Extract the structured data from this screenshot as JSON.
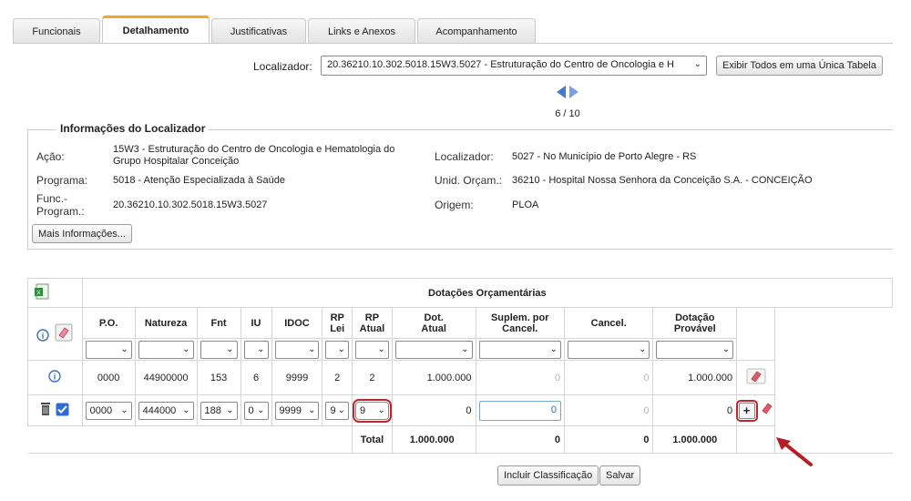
{
  "tabs": [
    {
      "label": "Funcionais"
    },
    {
      "label": "Detalhamento"
    },
    {
      "label": "Justificativas"
    },
    {
      "label": "Links e Anexos"
    },
    {
      "label": "Acompanhamento"
    }
  ],
  "localizador": {
    "label": "Localizador:",
    "selected": "20.36210.10.302.5018.15W3.5027 - Estruturação do Centro de Oncologia e H",
    "show_all_button": "Exibir Todos em uma Única Tabela",
    "page": "6 / 10"
  },
  "info": {
    "legend": "Informações do Localizador",
    "acao_label": "Ação:",
    "acao_value": "15W3 - Estruturação do Centro de Oncologia e Hematologia do Grupo Hospitalar Conceição",
    "programa_label": "Programa:",
    "programa_value": "5018 - Atenção Especializada à Saúde",
    "func_label": "Func.-Program.:",
    "func_value": "20.36210.10.302.5018.15W3.5027",
    "localizador_label": "Localizador:",
    "localizador_value": "5027 - No Município de Porto Alegre - RS",
    "unid_label": "Unid. Orçam.:",
    "unid_value": "36210 - Hospital Nossa Senhora da Conceição S.A. - CONCEIÇÃO",
    "origem_label": "Origem:",
    "origem_value": "PLOA",
    "more_button": "Mais Informações..."
  },
  "table": {
    "title": "Dotações Orçamentárias",
    "headers": {
      "po": "P.O.",
      "natureza": "Natureza",
      "fnt": "Fnt",
      "iu": "IU",
      "idoc": "IDOC",
      "rp_lei_1": "RP",
      "rp_lei_2": "Lei",
      "rp_atual_1": "RP",
      "rp_atual_2": "Atual",
      "dot_atual_1": "Dot.",
      "dot_atual_2": "Atual",
      "suplem_1": "Suplem. por",
      "suplem_2": "Cancel.",
      "cancel": "Cancel.",
      "dotacao_1": "Dotação",
      "dotacao_2": "Provável"
    },
    "row1": {
      "po": "0000",
      "natureza": "44900000",
      "fnt": "153",
      "iu": "6",
      "idoc": "9999",
      "rp_lei": "2",
      "rp_atual": "2",
      "dot_atual": "1.000.000",
      "suplem": "0",
      "cancel": "0",
      "dotacao": "1.000.000"
    },
    "row2": {
      "po": "0000",
      "natureza": "444000",
      "fnt": "188",
      "iu": "0",
      "idoc": "9999",
      "rp_lei": "9",
      "rp_atual": "9",
      "dot_atual": "0",
      "suplem": "0",
      "cancel": "0",
      "dotacao": "0",
      "add_button": "+"
    },
    "total": {
      "label": "Total",
      "dot_atual": "1.000.000",
      "suplem": "0",
      "cancel": "0",
      "dotacao": "1.000.000"
    }
  },
  "actions": {
    "incluir": "Incluir Classificação",
    "salvar": "Salvar"
  },
  "colors": {
    "accent_tab": "#f5a623",
    "highlight": "#c0262b",
    "info_icon": "#3b6fc2",
    "checkbox": "#2d6cd6"
  }
}
